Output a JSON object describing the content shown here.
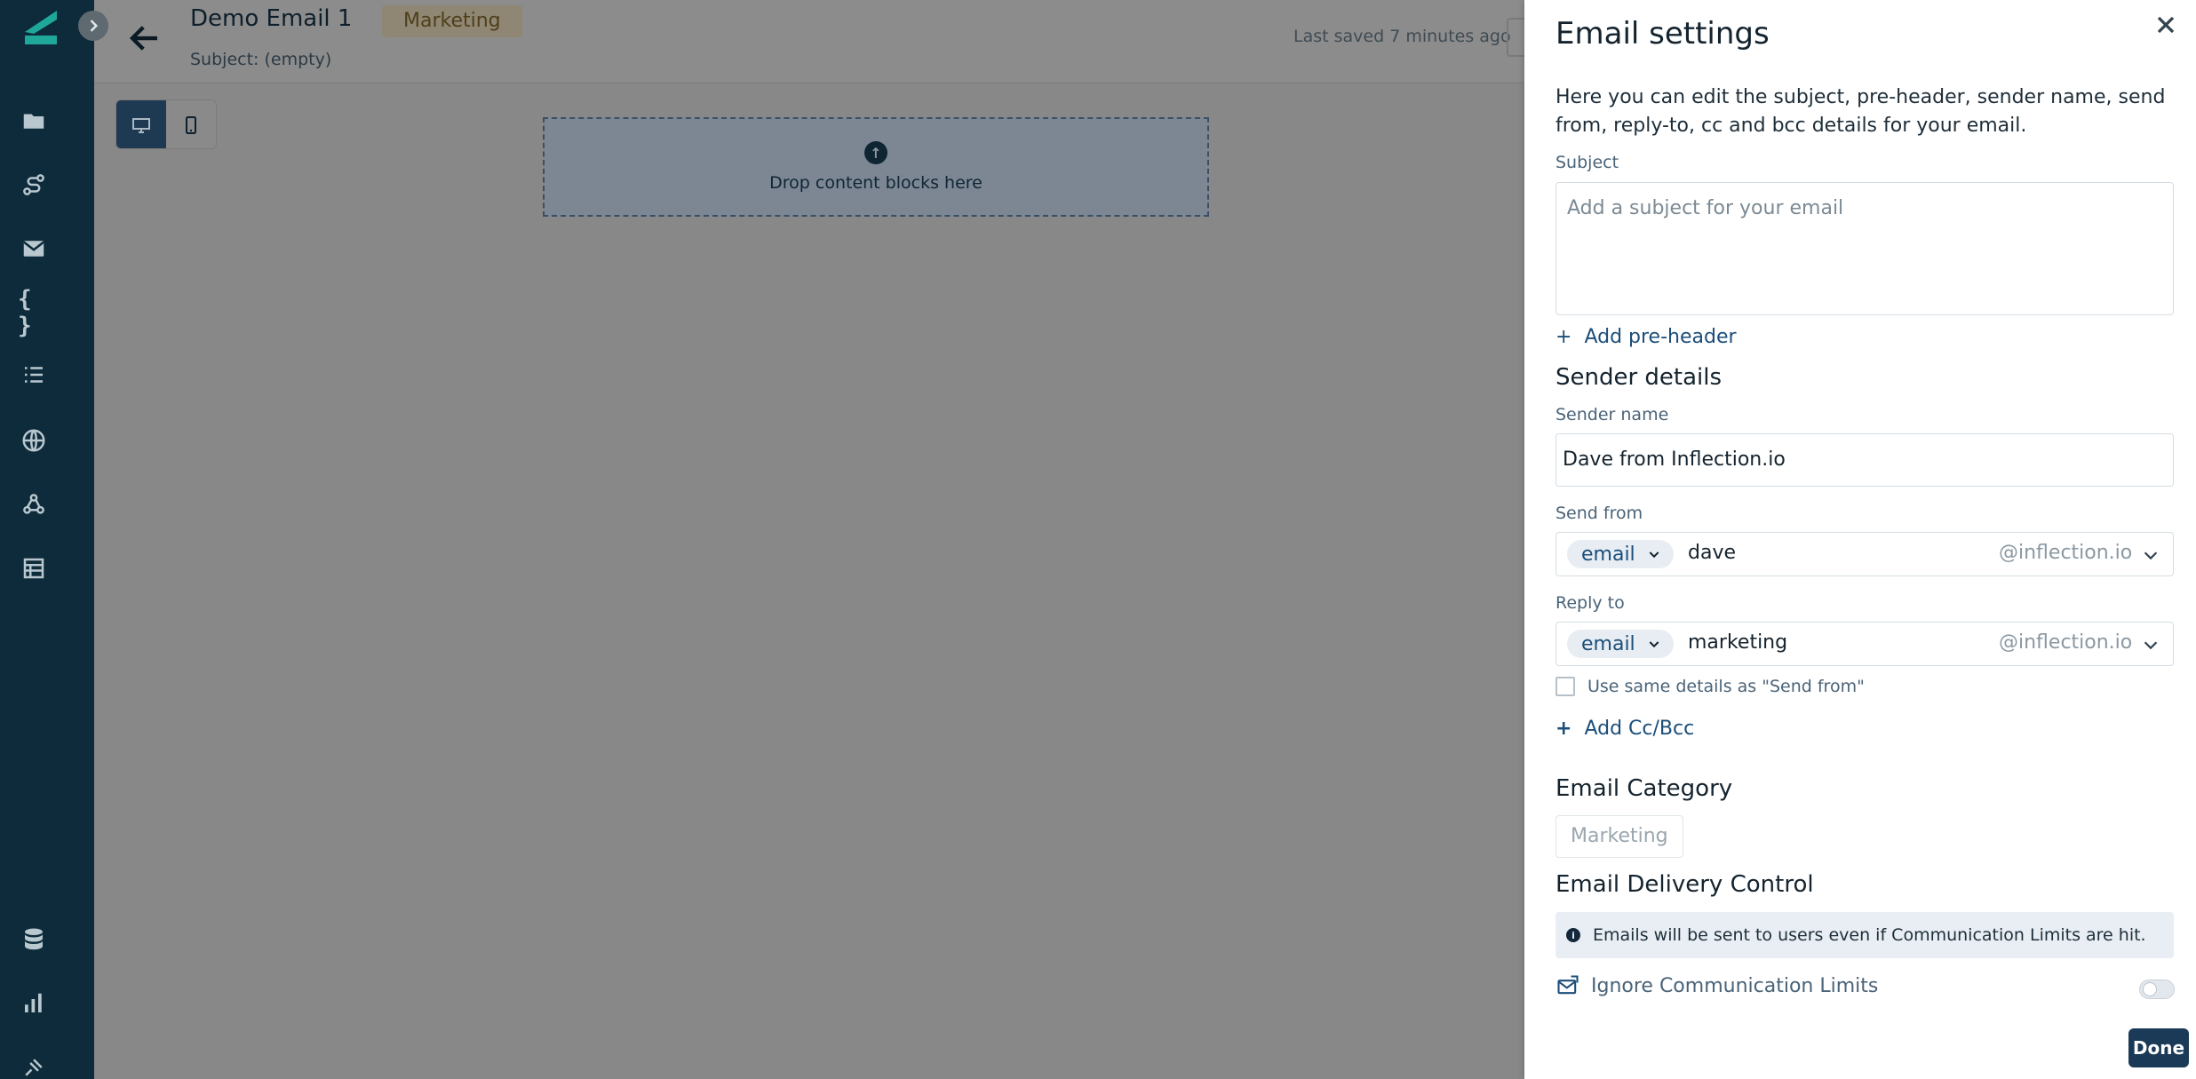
{
  "editor": {
    "title": "Demo Email 1",
    "category_badge": "Marketing",
    "subject_line": "Subject: (empty)",
    "last_saved": "Last saved 7 minutes ago",
    "drop_zone_text": "Drop content blocks here",
    "view_modes": [
      "desktop-icon",
      "mobile-icon"
    ],
    "active_view": "desktop"
  },
  "sidebar": {
    "items": [
      {
        "icon": "folder-icon"
      },
      {
        "icon": "journey-icon"
      },
      {
        "icon": "mail-icon"
      },
      {
        "icon": "braces-icon",
        "glyph": "{ }"
      },
      {
        "icon": "list-icon"
      },
      {
        "icon": "globe-icon"
      },
      {
        "icon": "webhook-icon"
      },
      {
        "icon": "table-icon"
      },
      {
        "icon": "database-icon"
      },
      {
        "icon": "analytics-icon"
      },
      {
        "icon": "settings-plug-icon"
      }
    ]
  },
  "settings": {
    "title": "Email settings",
    "description": "Here you can edit the subject, pre-header, sender name, send from, reply-to, cc and bcc details for your email.",
    "subject_label": "Subject",
    "subject_placeholder": "Add a subject for your email",
    "add_preheader": "Add pre-header",
    "sender_section": "Sender details",
    "sender_name_label": "Sender name",
    "sender_name_value": "Dave from Inflection.io",
    "send_from_label": "Send from",
    "send_from_type": "email",
    "send_from_value": "dave",
    "send_from_domain": "@inflection.io",
    "reply_to_label": "Reply to",
    "reply_to_type": "email",
    "reply_to_value": "marketing",
    "reply_to_domain": "@inflection.io",
    "same_details_label": "Use same details as \"Send from\"",
    "add_ccbcc": "Add Cc/Bcc",
    "category_section": "Email Category",
    "category_value": "Marketing",
    "delivery_section": "Email Delivery Control",
    "delivery_info": "Emails will be sent to users even if Communication Limits are hit.",
    "ignore_limits_label": "Ignore Communication Limits",
    "ignore_limits_enabled": false,
    "done_label": "Done"
  },
  "colors": {
    "nav_bg": "#0d2b3a",
    "brand_accent": "#1fa89a",
    "link": "#1b4e7a",
    "primary_button": "#1a3a57"
  }
}
